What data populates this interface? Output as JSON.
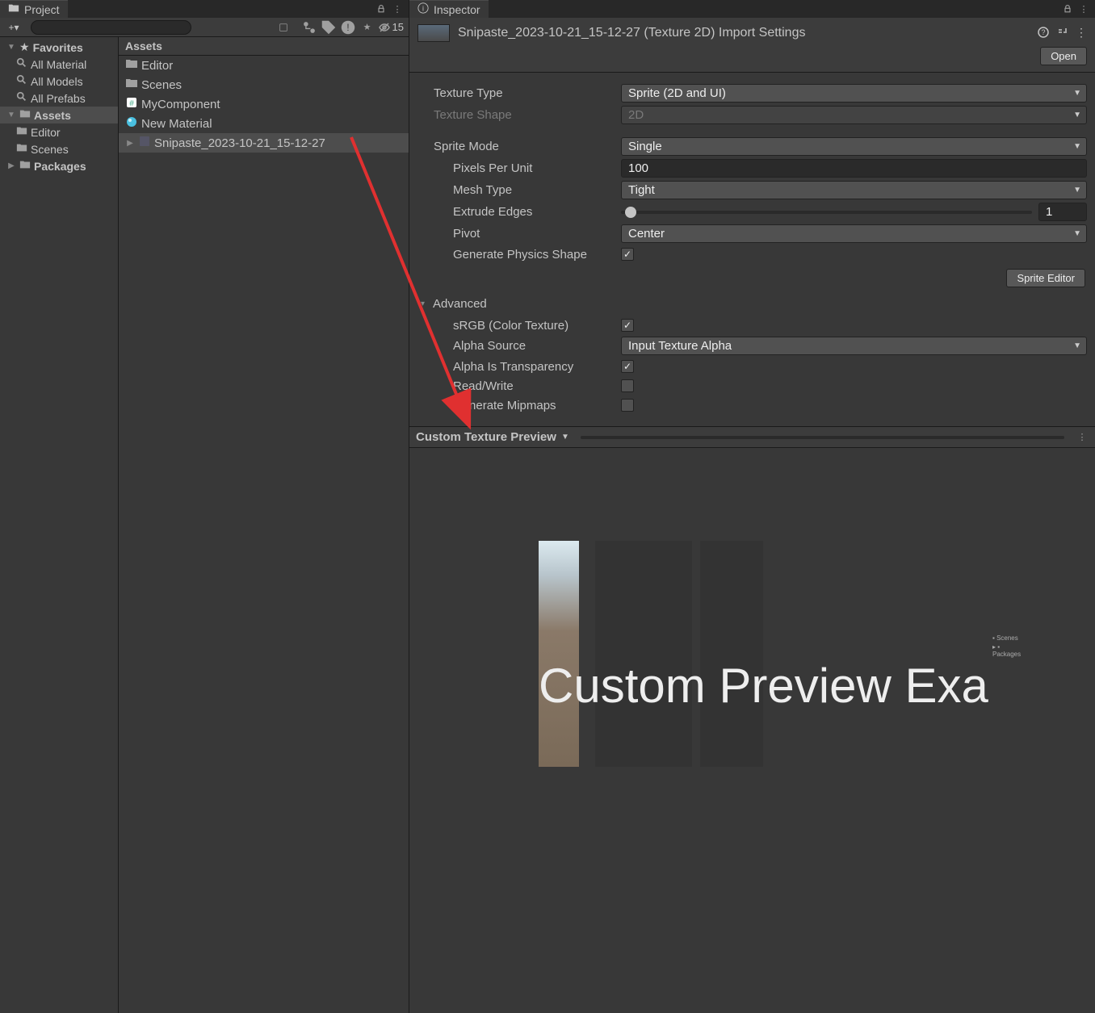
{
  "project": {
    "tab_label": "Project",
    "add_icon": "+",
    "search_placeholder": "",
    "hidden_count": "15",
    "favorites_label": "Favorites",
    "favorites": [
      {
        "label": "All Material"
      },
      {
        "label": "All Models"
      },
      {
        "label": "All Prefabs"
      }
    ],
    "assets_label": "Assets",
    "assets_children": [
      {
        "label": "Editor"
      },
      {
        "label": "Scenes"
      }
    ],
    "packages_label": "Packages",
    "assets_panel_header": "Assets",
    "asset_items": [
      {
        "label": "Editor",
        "type": "folder"
      },
      {
        "label": "Scenes",
        "type": "folder"
      },
      {
        "label": "MyComponent",
        "type": "cs"
      },
      {
        "label": "New Material",
        "type": "mat"
      },
      {
        "label": "Snipaste_2023-10-21_15-12-27",
        "type": "tex",
        "selected": true
      }
    ]
  },
  "inspector": {
    "tab_label": "Inspector",
    "title": "Snipaste_2023-10-21_15-12-27 (Texture 2D) Import Settings",
    "open_label": "Open",
    "texture_type_label": "Texture Type",
    "texture_type_value": "Sprite (2D and UI)",
    "texture_shape_label": "Texture Shape",
    "texture_shape_value": "2D",
    "sprite_mode_label": "Sprite Mode",
    "sprite_mode_value": "Single",
    "pixels_per_unit_label": "Pixels Per Unit",
    "pixels_per_unit_value": "100",
    "mesh_type_label": "Mesh Type",
    "mesh_type_value": "Tight",
    "extrude_edges_label": "Extrude Edges",
    "extrude_edges_value": "1",
    "pivot_label": "Pivot",
    "pivot_value": "Center",
    "generate_physics_label": "Generate Physics Shape",
    "sprite_editor_label": "Sprite Editor",
    "advanced_label": "Advanced",
    "srgb_label": "sRGB (Color Texture)",
    "alpha_source_label": "Alpha Source",
    "alpha_source_value": "Input Texture Alpha",
    "alpha_transparency_label": "Alpha Is Transparency",
    "read_write_label": "Read/Write",
    "generate_mipmaps_label": "Generate Mipmaps",
    "preview_title": "Custom Texture Preview",
    "preview_overlay_text": "Custom Preview Exa",
    "mini_tree_scenes": "Scenes",
    "mini_tree_packages": "Packages"
  }
}
